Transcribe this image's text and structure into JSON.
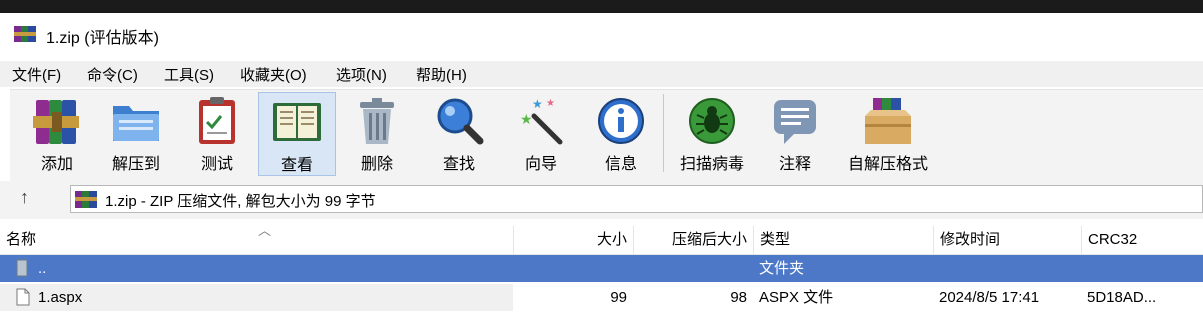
{
  "window": {
    "title": "1.zip (评估版本)"
  },
  "menu": [
    "文件(F)",
    "命令(C)",
    "工具(S)",
    "收藏夹(O)",
    "选项(N)",
    "帮助(H)"
  ],
  "toolbar": {
    "add": "添加",
    "extract_to": "解压到",
    "test": "测试",
    "view": "查看",
    "delete": "删除",
    "find": "查找",
    "wizard": "向导",
    "info": "信息",
    "virus_scan": "扫描病毒",
    "comment": "注释",
    "sfx": "自解压格式"
  },
  "address": {
    "up_symbol": "↑",
    "text": "1.zip - ZIP 压缩文件, 解包大小为 99 字节"
  },
  "columns": {
    "name": "名称",
    "size": "大小",
    "packed": "压缩后大小",
    "type": "类型",
    "modified": "修改时间",
    "crc": "CRC32"
  },
  "rows": [
    {
      "name": "..",
      "size": "",
      "packed": "",
      "type": "文件夹",
      "modified": "",
      "crc": ""
    },
    {
      "name": "1.aspx",
      "size": "99",
      "packed": "98",
      "type": "ASPX 文件",
      "modified": "2024/8/5 17:41",
      "crc": "5D18AD..."
    }
  ],
  "colors": {
    "selection": "#4d78c8",
    "toolbar_bg": "#f3f3f3"
  }
}
